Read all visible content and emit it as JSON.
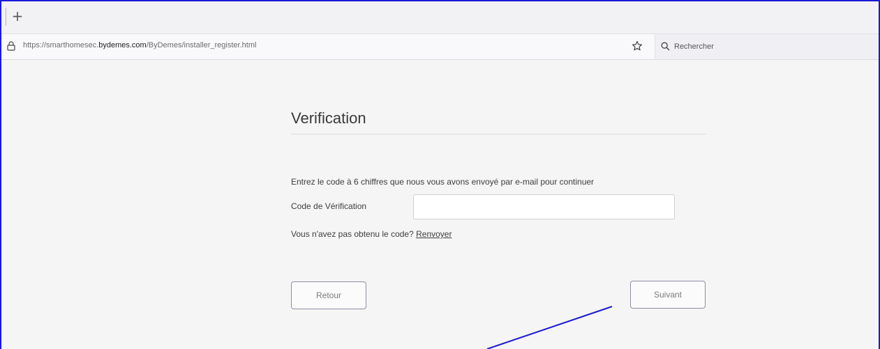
{
  "browser": {
    "new_tab_symbol": "+",
    "url_prefix": "https://smarthomesec.",
    "url_host": "bydemes.com",
    "url_path": "/ByDemes/installer_register.html",
    "search_placeholder": "Rechercher"
  },
  "page": {
    "title": "Verification",
    "instructions": "Entrez le code à 6 chiffres que nous vous avons envoyé par e-mail pour continuer",
    "code_label": "Code de Vérification",
    "code_value": "",
    "resend_prompt": "Vous n'avez pas obtenu le code?",
    "resend_link": "Renvoyer",
    "back_button": "Retour",
    "next_button": "Suivant"
  },
  "colors": {
    "annotation": "#1a1ad6",
    "button_border": "#8d8da5",
    "background": "#f5f5f5"
  }
}
